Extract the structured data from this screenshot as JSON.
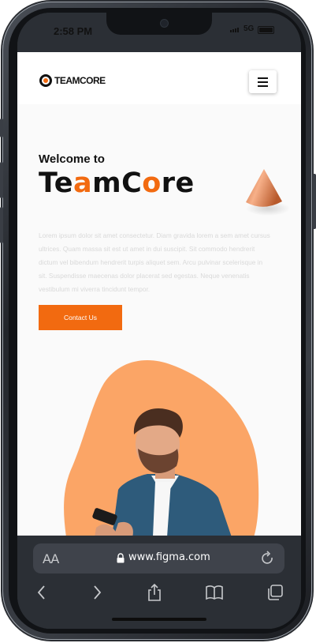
{
  "status_bar": {
    "time": "2:58 PM",
    "network": "5G"
  },
  "site": {
    "logo_text": "TEAMCORE",
    "welcome": "Welcome to",
    "headline_parts": [
      "Te",
      "a",
      "mC",
      "o",
      "re"
    ],
    "body": "Lorem ipsum dolor sit amet consectetur. Diam gravida lorem a sem amet cursus ultrices. Quam massa sit est ut amet in dui suscipit. Sit commodo hendrerit dictum vel bibendum hendrerit turpis aliquet sem. Arcu pulvinar scelerisque in sit. Suspendisse maecenas dolor placerat sed egestas. Neque venenatis vestibulum mi viverra tincidunt tempor.",
    "cta_label": "Contact Us"
  },
  "browser": {
    "aa_label": "AA",
    "url": "www.figma.com"
  },
  "icons": {
    "menu": "hamburger-menu-icon",
    "lock": "lock-icon",
    "reload": "reload-icon",
    "back": "back-chevron-icon",
    "forward": "forward-chevron-icon",
    "share": "share-icon",
    "bookmarks": "bookmarks-icon",
    "tabs": "tabs-icon"
  },
  "colors": {
    "accent": "#f26a10",
    "blob": "#fba566",
    "browser_chrome": "#2b2f35"
  }
}
